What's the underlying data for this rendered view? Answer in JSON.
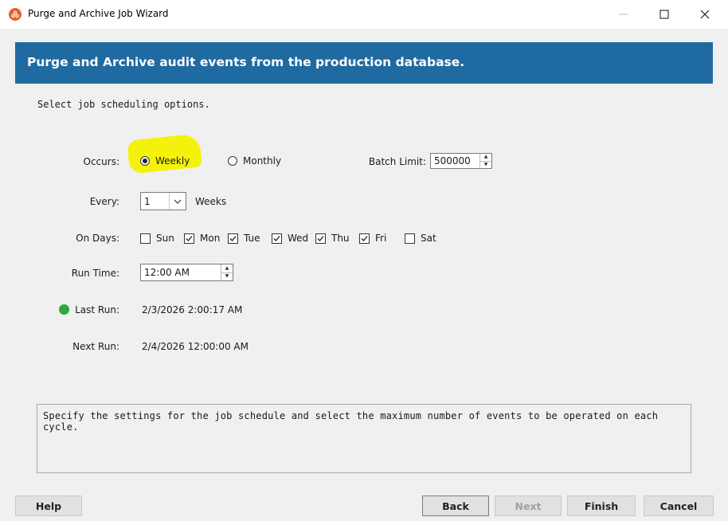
{
  "window": {
    "title": "Purge and Archive Job Wizard"
  },
  "header": {
    "title": "Purge and Archive audit events from the production database."
  },
  "instruction": "Select job scheduling options.",
  "occurs": {
    "label": "Occurs:",
    "options": [
      "Weekly",
      "Monthly"
    ],
    "selected": "Weekly"
  },
  "batch_limit": {
    "label": "Batch Limit:",
    "value": "500000"
  },
  "every": {
    "label": "Every:",
    "value": "1",
    "unit": "Weeks"
  },
  "on_days": {
    "label": "On Days:",
    "days": [
      {
        "name": "Sun",
        "checked": false
      },
      {
        "name": "Mon",
        "checked": true
      },
      {
        "name": "Tue",
        "checked": true
      },
      {
        "name": "Wed",
        "checked": true
      },
      {
        "name": "Thu",
        "checked": true
      },
      {
        "name": "Fri",
        "checked": true
      },
      {
        "name": "Sat",
        "checked": false
      }
    ]
  },
  "run_time": {
    "label": "Run Time:",
    "value": "12:00 AM"
  },
  "last_run": {
    "label": "Last Run:",
    "value": "2/3/2026 2:00:17 AM",
    "status_color": "#2eaa3a"
  },
  "next_run": {
    "label": "Next Run:",
    "value": "2/4/2026 12:00:00 AM"
  },
  "description": "Specify the settings for the job schedule and select the maximum number of events to be operated on each cycle.",
  "buttons": {
    "help": "Help",
    "back": "Back",
    "next": "Next",
    "finish": "Finish",
    "cancel": "Cancel"
  },
  "colors": {
    "header_band": "#1f6aa0",
    "highlight": "#f4f20a"
  }
}
